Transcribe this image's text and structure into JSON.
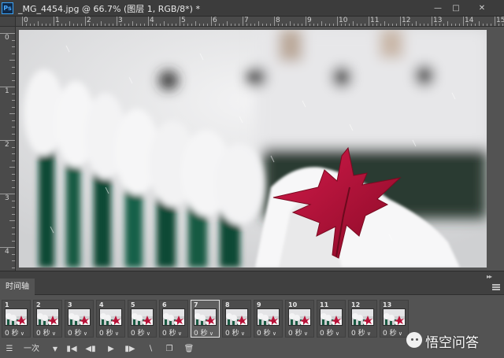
{
  "window": {
    "title": "_MG_4454.jpg @ 66.7% (图层 1, RGB/8*) *",
    "app_icon": "Ps",
    "minimize_icon": "minimize-icon",
    "maximize_icon": "maximize-icon",
    "close_icon": "close-icon"
  },
  "rulers": {
    "top_labels": [
      "0",
      "1",
      "2",
      "3",
      "4",
      "5",
      "6",
      "7",
      "8",
      "9",
      "10",
      "11",
      "12",
      "13",
      "14",
      "15"
    ],
    "left_labels": [
      "0",
      "1",
      "2",
      "3",
      "4"
    ]
  },
  "canvas": {
    "zoom": "66.7%",
    "image_subject": "red maple leaf on snow-covered fence",
    "colors": {
      "leaf": "#b0123a",
      "snow": "#f2f2f2",
      "fence": "#1f4a3a"
    }
  },
  "timeline": {
    "tab_label": "时间轴",
    "collapse_icon": "double-chevron-icon",
    "menu_icon": "hamburger-menu-icon",
    "selected_frame": "7",
    "frames": [
      {
        "number": "1",
        "delay": "0 秒"
      },
      {
        "number": "2",
        "delay": "0 秒"
      },
      {
        "number": "3",
        "delay": "0 秒"
      },
      {
        "number": "4",
        "delay": "0 秒"
      },
      {
        "number": "5",
        "delay": "0 秒"
      },
      {
        "number": "6",
        "delay": "0 秒"
      },
      {
        "number": "7",
        "delay": "0 秒"
      },
      {
        "number": "8",
        "delay": "0 秒"
      },
      {
        "number": "9",
        "delay": "0 秒"
      },
      {
        "number": "10",
        "delay": "0 秒"
      },
      {
        "number": "11",
        "delay": "0 秒"
      },
      {
        "number": "12",
        "delay": "0 秒"
      },
      {
        "number": "13",
        "delay": "0 秒"
      }
    ],
    "controls": {
      "convert_icon": "convert-timeline-icon",
      "loop_label": "一次",
      "loop_dropdown_icon": "dropdown-arrow-icon",
      "first_frame_icon": "first-frame-icon",
      "prev_frame_icon": "previous-frame-icon",
      "play_icon": "play-icon",
      "next_frame_icon": "next-frame-icon",
      "tween_icon": "tween-icon",
      "duplicate_icon": "duplicate-frame-icon",
      "delete_icon": "trash-icon"
    }
  },
  "watermark": {
    "text": "悟空问答",
    "logo_icon": "wukong-logo-icon"
  }
}
